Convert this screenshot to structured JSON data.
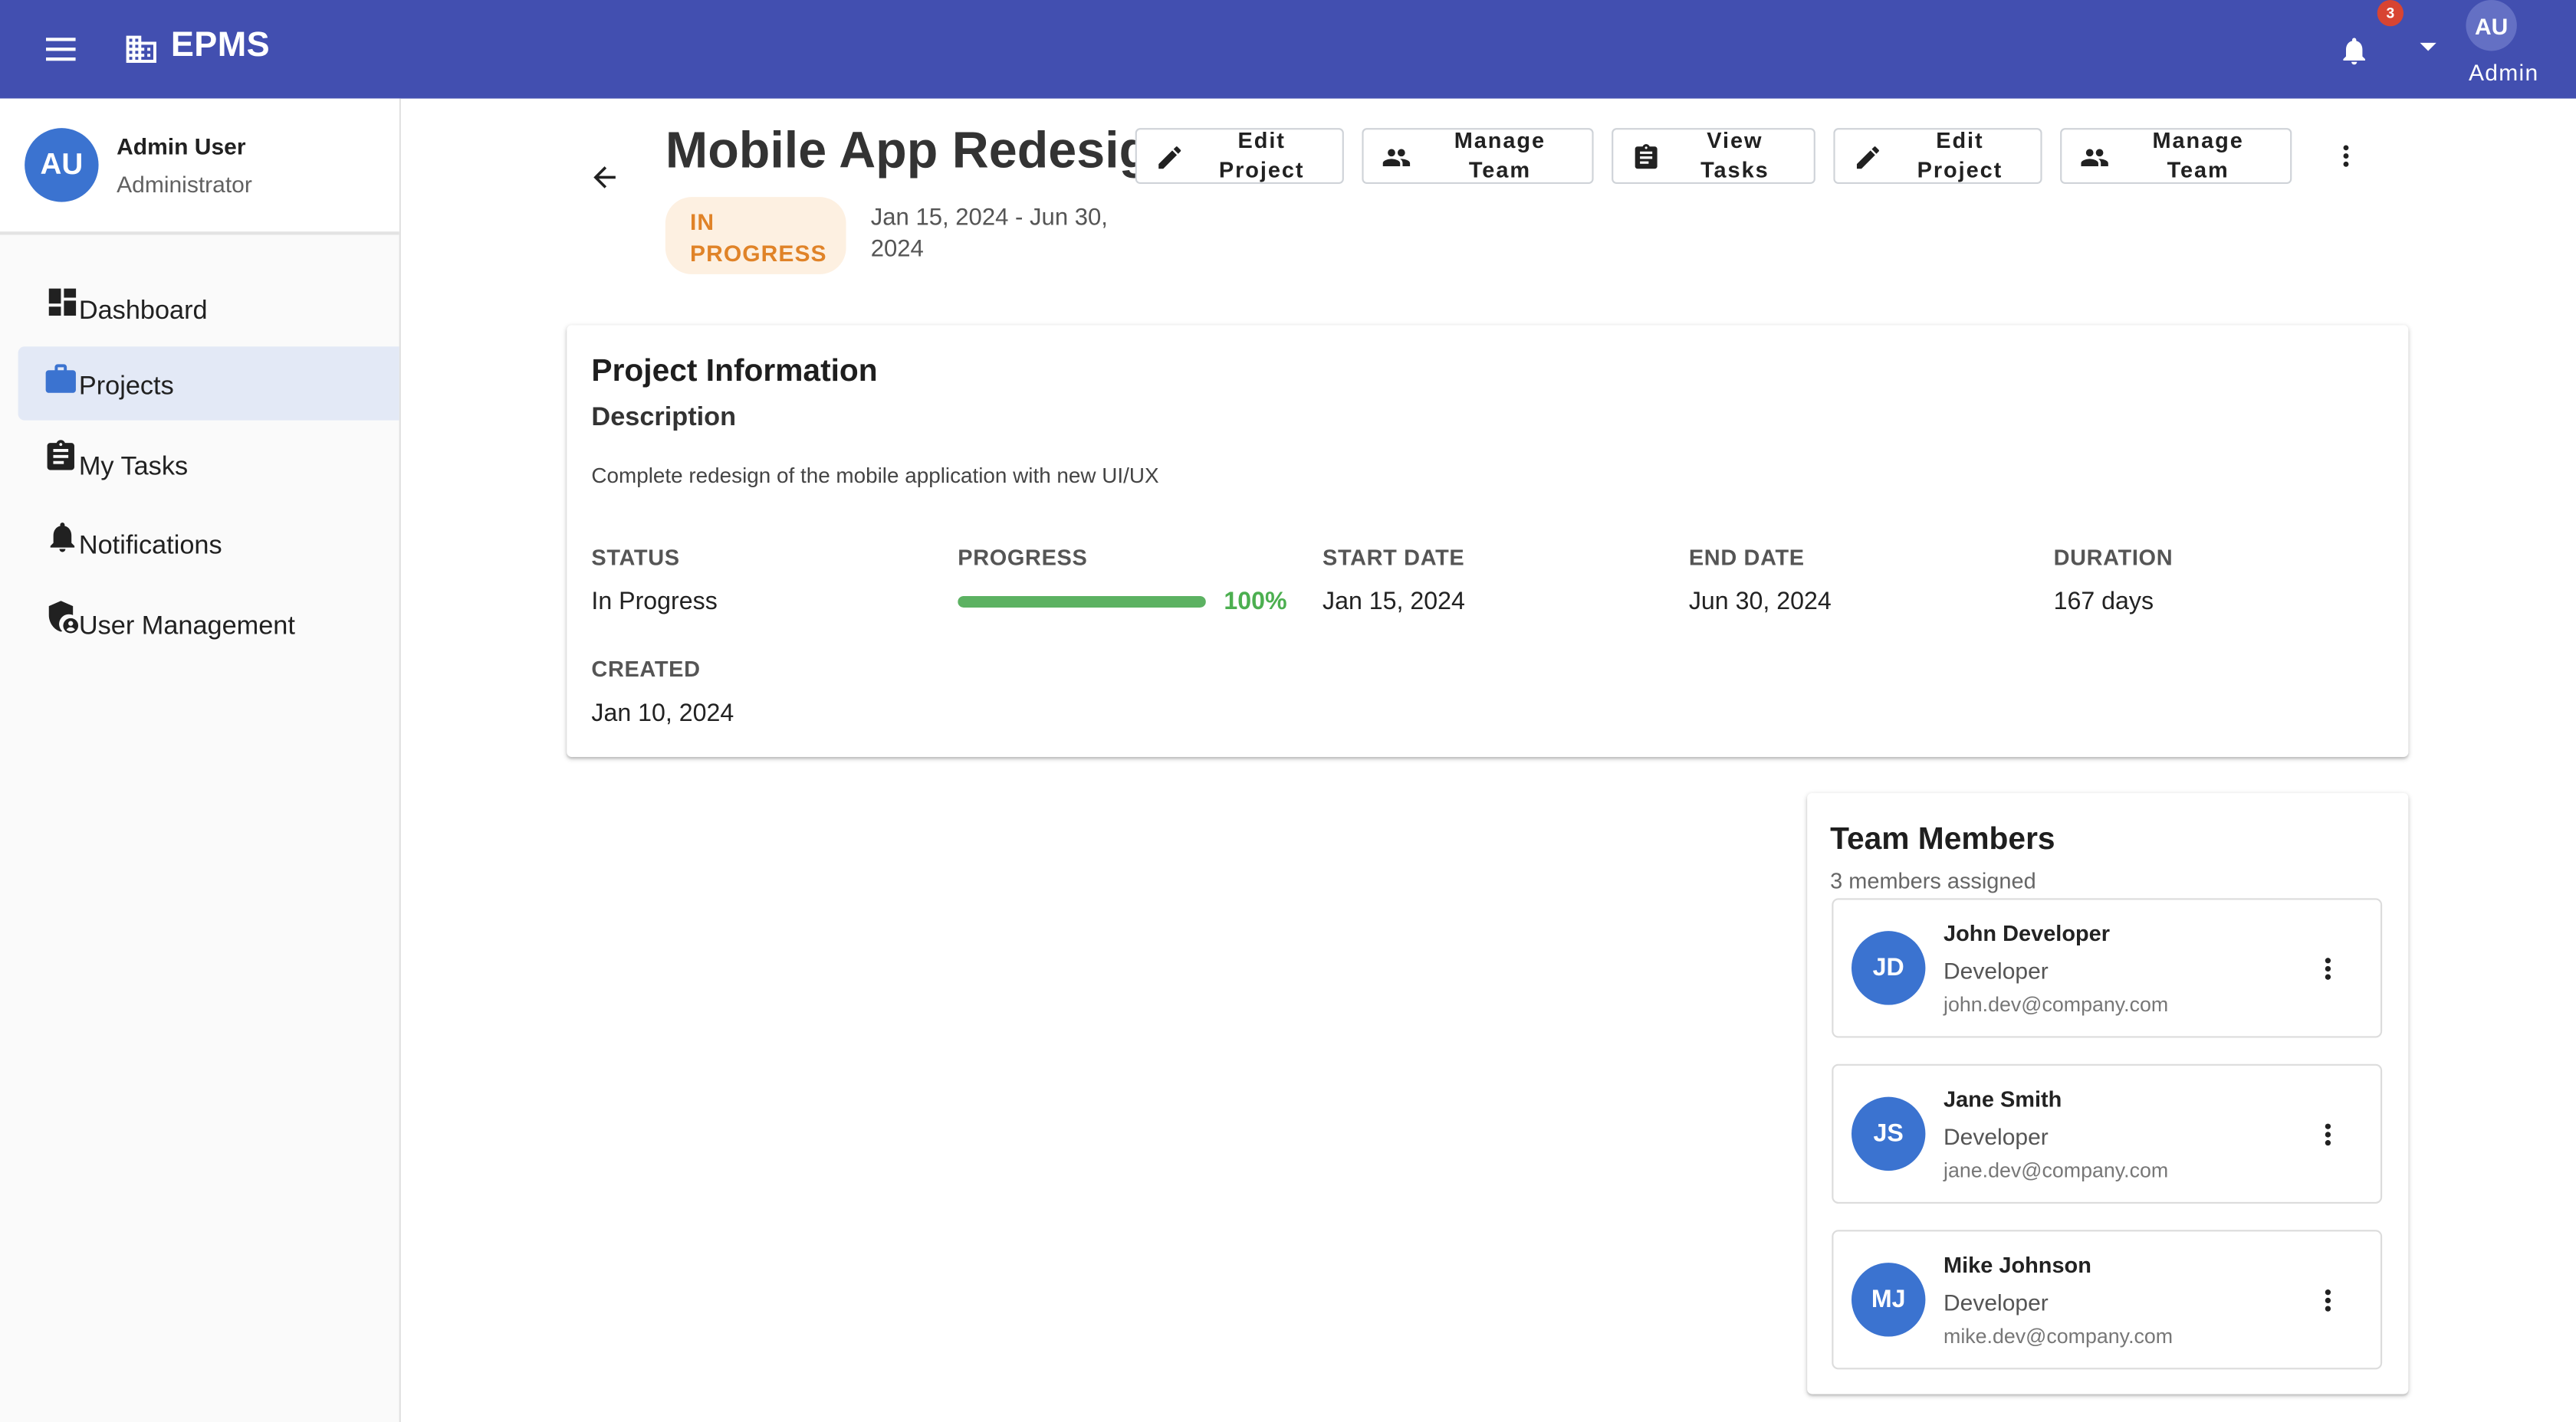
{
  "app": {
    "title": "EPMS",
    "notification_count": "3",
    "user_initials": "AU",
    "user_label": "Admin",
    "brand_color": "#424fb0"
  },
  "sidebar": {
    "user_name": "Admin User",
    "user_role": "Administrator",
    "user_initials": "AU",
    "items": [
      {
        "label": "Dashboard",
        "icon": "dashboard-icon",
        "active": false
      },
      {
        "label": "Projects",
        "icon": "briefcase-icon",
        "active": true
      },
      {
        "label": "My Tasks",
        "icon": "clipboard-icon",
        "active": false
      },
      {
        "label": "Notifications",
        "icon": "bell-icon",
        "active": false
      },
      {
        "label": "User Management",
        "icon": "shield-user-icon",
        "active": false
      }
    ]
  },
  "project": {
    "title": "Mobile App Redesign",
    "status_chip": "IN PROGRESS",
    "date_range": "Jan 15, 2024 - Jun 30, 2024",
    "actions": [
      {
        "label": "Edit Project",
        "icon": "pencil-icon"
      },
      {
        "label": "Manage Team",
        "icon": "people-icon"
      },
      {
        "label": "View Tasks",
        "icon": "clipboard-icon"
      },
      {
        "label": "Edit Project",
        "icon": "pencil-icon"
      },
      {
        "label": "Manage Team",
        "icon": "people-icon"
      }
    ]
  },
  "info": {
    "title": "Project Information",
    "description_title": "Description",
    "description": "Complete redesign of the mobile application with new UI/UX",
    "status_label": "STATUS",
    "status_value": "In Progress",
    "progress_label": "PROGRESS",
    "progress_value": 100,
    "progress_text": "100%",
    "start_label": "START DATE",
    "start_value": "Jan 15, 2024",
    "end_label": "END DATE",
    "end_value": "Jun 30, 2024",
    "duration_label": "DURATION",
    "duration_value": "167 days",
    "created_label": "CREATED",
    "created_value": "Jan 10, 2024"
  },
  "team": {
    "title": "Team Members",
    "subtitle": "3 members assigned",
    "members": [
      {
        "initials": "JD",
        "name": "John Developer",
        "role": "Developer",
        "email": "john.dev@company.com"
      },
      {
        "initials": "JS",
        "name": "Jane Smith",
        "role": "Developer",
        "email": "jane.dev@company.com"
      },
      {
        "initials": "MJ",
        "name": "Mike Johnson",
        "role": "Developer",
        "email": "mike.dev@company.com"
      }
    ]
  }
}
